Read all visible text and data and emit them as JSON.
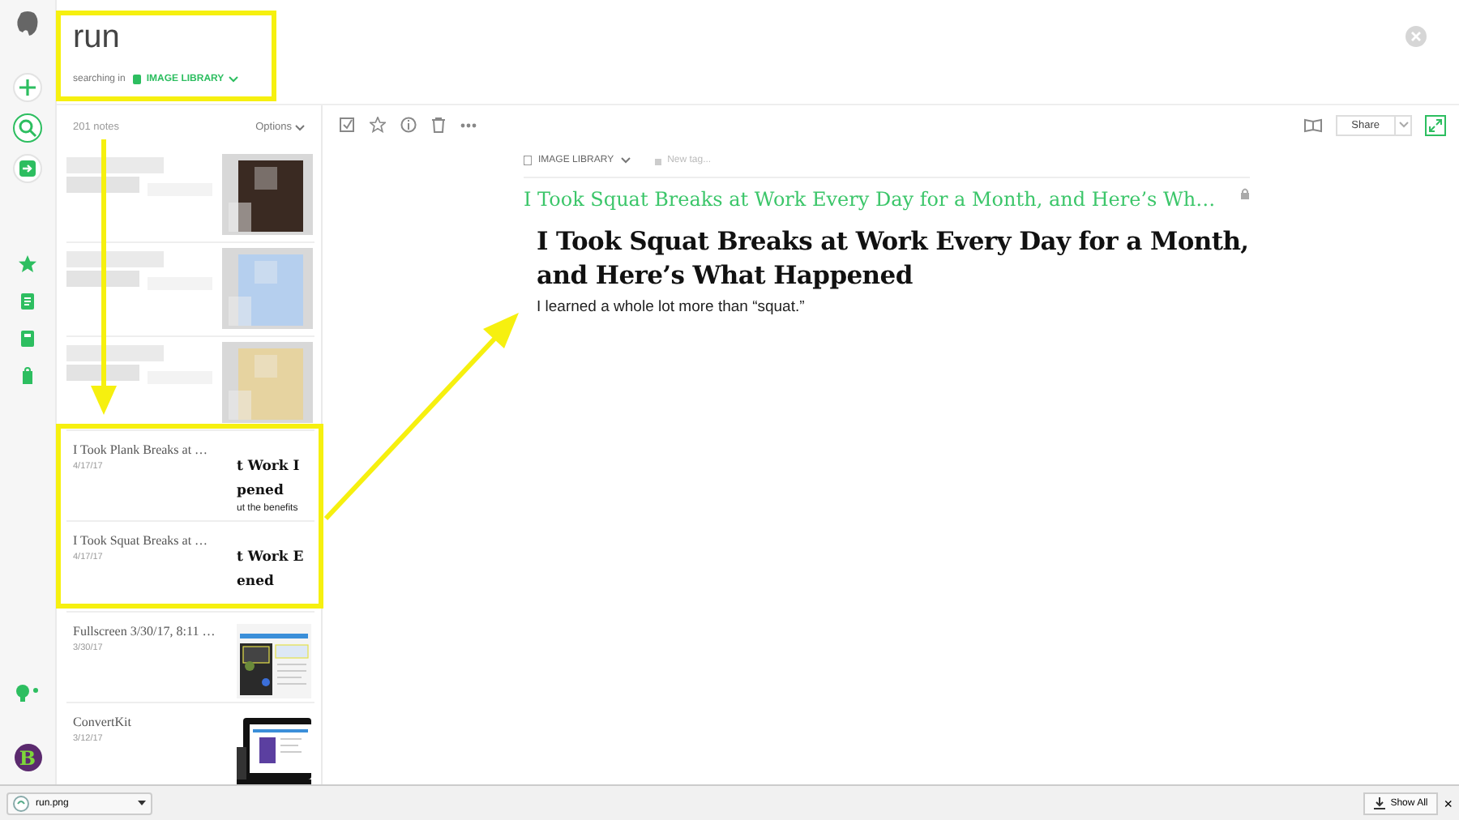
{
  "sidebar": {
    "items": [
      {
        "kind": "new",
        "selected": false
      },
      {
        "kind": "search",
        "selected": true
      },
      {
        "kind": "work-chat",
        "selected": false
      },
      {
        "kind": "shortcuts",
        "selected": false
      },
      {
        "kind": "notes",
        "selected": false
      },
      {
        "kind": "notebooks",
        "selected": false
      },
      {
        "kind": "tags",
        "selected": false
      }
    ],
    "avatar": "B"
  },
  "search": {
    "query": "run",
    "scope_label": "searching in",
    "notebook": "IMAGE LIBRARY"
  },
  "note_list": {
    "count": "201 notes",
    "options": "Options",
    "notes": [
      {
        "kind": "picture"
      },
      {
        "kind": "picture"
      },
      {
        "kind": "picture"
      },
      {
        "kind": "text",
        "title": "I Took Plank Breaks at …",
        "date": "4/17/17",
        "thumbnail": {
          "kind": "article",
          "lines": [
            {
              "kind": "heading",
              "text": "t Work I"
            },
            {
              "kind": "heading",
              "text": "pened"
            },
            {
              "kind": "body",
              "text": "ut the benefits"
            }
          ]
        }
      },
      {
        "kind": "text",
        "title": "I Took Squat Breaks at …",
        "date": "4/17/17",
        "thumbnail": {
          "kind": "article",
          "lines": [
            {
              "kind": "heading",
              "text": "t Work E"
            },
            {
              "kind": "heading",
              "text": "ened"
            }
          ]
        }
      },
      {
        "kind": "text",
        "title": "Fullscreen 3/30/17, 8:11 …",
        "date": "3/30/17",
        "thumbnail": {
          "kind": "dark-screenshot"
        }
      },
      {
        "kind": "text",
        "title": "ConvertKit",
        "date": "3/12/17",
        "thumbnail": {
          "kind": "laptop-screenshot"
        }
      }
    ]
  },
  "editor": {
    "share": "Share",
    "notebook": "IMAGE LIBRARY",
    "tag_placeholder": "New tag...",
    "title": "I Took Squat Breaks at Work Every Day for a Month, and Here’s Wh…",
    "heading": "I Took Squat Breaks at Work Every Day for a Month, and Here’s What Happened",
    "subtitle": "I learned a whole lot more than “squat.”"
  },
  "download_bar": {
    "file": "run.png",
    "show_all": "Show All",
    "close": "×"
  }
}
